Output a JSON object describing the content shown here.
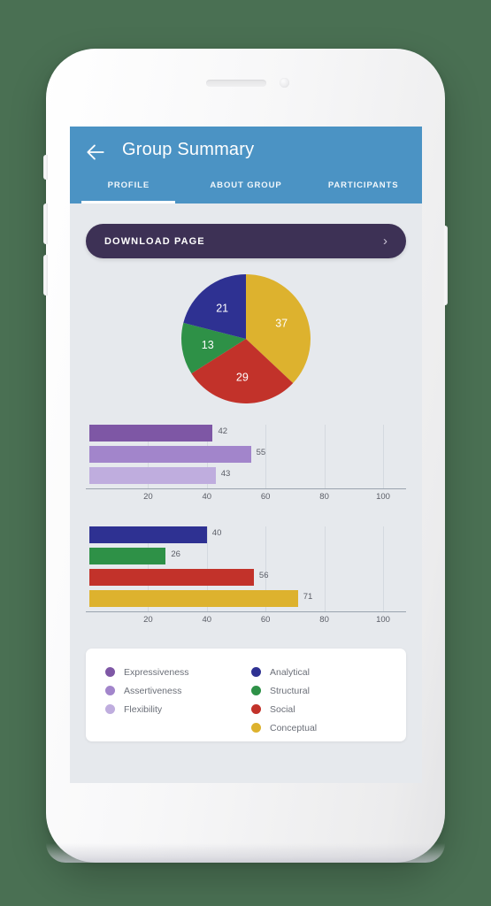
{
  "app": {
    "title": "Group Summary",
    "back_icon": "back-arrow-icon",
    "header_color": "#4b93c4"
  },
  "tabs": [
    {
      "label": "PROFILE",
      "active": true
    },
    {
      "label": "ABOUT GROUP",
      "active": false
    },
    {
      "label": "PARTICIPANTS",
      "active": false
    }
  ],
  "download": {
    "label": "DOWNLOAD PAGE",
    "chevron": "›",
    "color": "#3d3155"
  },
  "chart_data": [
    {
      "type": "pie",
      "title": "",
      "categories": [
        "Conceptual",
        "Social",
        "Structural",
        "Analytical"
      ],
      "values": [
        37,
        29,
        13,
        21
      ],
      "colors": [
        "#ddb22e",
        "#c2322a",
        "#2e9147",
        "#2e3192"
      ],
      "labels": [
        "37",
        "29",
        "13",
        "21"
      ],
      "label_color": "#ffffff",
      "start_angle_deg": 0,
      "total": 100
    },
    {
      "type": "bar",
      "orientation": "horizontal",
      "title": "",
      "categories": [
        "Expressiveness",
        "Assertiveness",
        "Flexibility"
      ],
      "values": [
        42,
        55,
        43
      ],
      "colors": [
        "#7e57a5",
        "#a285cb",
        "#bfadde"
      ],
      "xlabel": "",
      "ylabel": "",
      "xlim": [
        0,
        100
      ],
      "xticks": [
        20,
        40,
        60,
        80,
        100
      ],
      "grid": true,
      "legend": "below"
    },
    {
      "type": "bar",
      "orientation": "horizontal",
      "title": "",
      "categories": [
        "Analytical",
        "Structural",
        "Social",
        "Conceptual"
      ],
      "values": [
        40,
        26,
        56,
        71
      ],
      "colors": [
        "#2e3192",
        "#2e9147",
        "#c2322a",
        "#ddb22e"
      ],
      "xlabel": "",
      "ylabel": "",
      "xlim": [
        0,
        100
      ],
      "xticks": [
        20,
        40,
        60,
        80,
        100
      ],
      "grid": true,
      "legend": "below"
    }
  ],
  "legend": {
    "left_column": [
      {
        "label": "Expressiveness",
        "color": "#7e57a5"
      },
      {
        "label": "Assertiveness",
        "color": "#a285cb"
      },
      {
        "label": "Flexibility",
        "color": "#bfadde"
      }
    ],
    "right_column": [
      {
        "label": "Analytical",
        "color": "#2e3192"
      },
      {
        "label": "Structural",
        "color": "#2e9147"
      },
      {
        "label": "Social",
        "color": "#c2322a"
      },
      {
        "label": "Conceptual",
        "color": "#ddb22e"
      }
    ]
  },
  "device": {
    "speaker": "speaker-grille",
    "camera": "front-camera"
  }
}
